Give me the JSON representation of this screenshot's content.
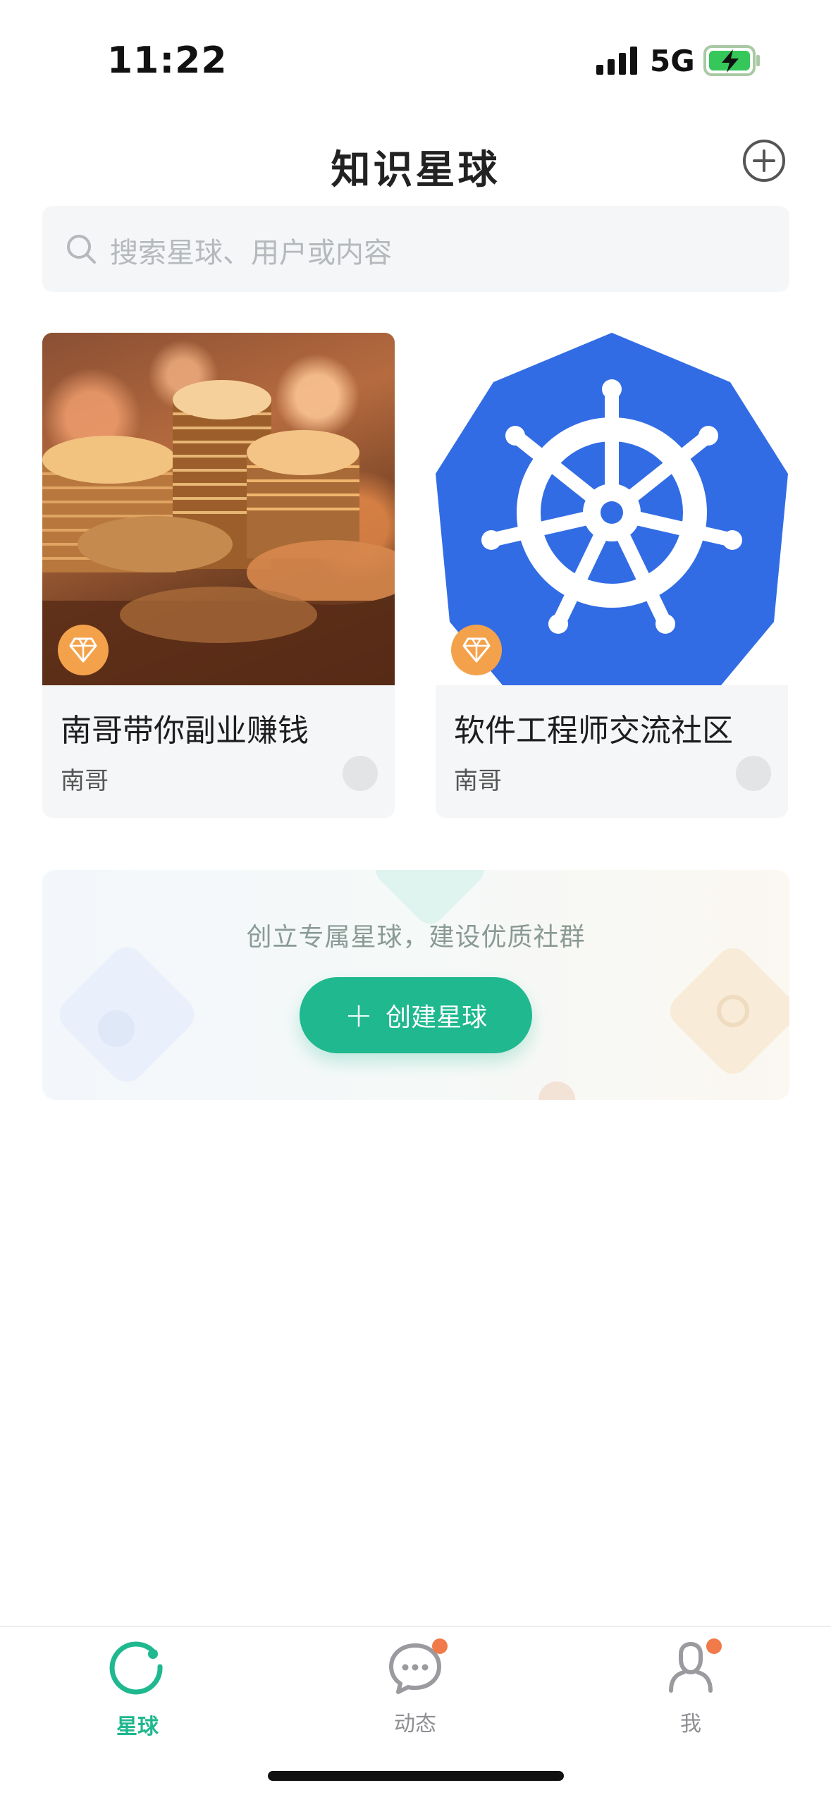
{
  "status": {
    "time": "11:22",
    "network": "5G"
  },
  "header": {
    "title": "知识星球"
  },
  "search": {
    "placeholder": "搜索星球、用户或内容"
  },
  "planets": [
    {
      "title": "南哥带你副业赚钱",
      "owner": "南哥",
      "cover_icon": "coins-photo",
      "badge_icon": "diamond-icon"
    },
    {
      "title": "软件工程师交流社区",
      "owner": "南哥",
      "cover_icon": "kubernetes-helm-icon",
      "badge_icon": "diamond-icon"
    }
  ],
  "banner": {
    "tagline": "创立专属星球，建设优质社群",
    "button_label": "创建星球"
  },
  "tabs": [
    {
      "label": "星球",
      "icon": "planet-icon",
      "active": true
    },
    {
      "label": "动态",
      "icon": "chat-bubble-icon",
      "active": false,
      "has_dot": true
    },
    {
      "label": "我",
      "icon": "user-icon",
      "active": false,
      "has_dot": true
    }
  ],
  "colors": {
    "accent": "#1fb88f",
    "badge": "#f3a24b",
    "kubernetes_blue": "#326ce5",
    "notification_dot": "#f07a4a"
  }
}
